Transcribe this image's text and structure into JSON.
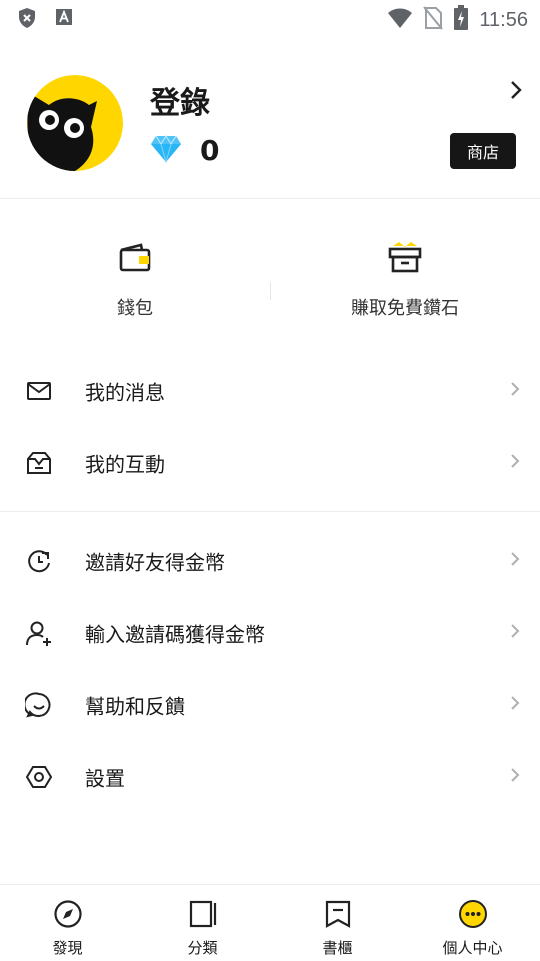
{
  "status_bar": {
    "time": "11:56",
    "icons": [
      "shield-icon",
      "font-icon",
      "wifi-icon",
      "no-sim-icon",
      "battery-charging-icon"
    ]
  },
  "profile": {
    "login_label": "登錄",
    "diamond_count": "0",
    "shop_label": "商店"
  },
  "quick_actions": [
    {
      "label": "錢包",
      "icon": "wallet-icon"
    },
    {
      "label": "賺取免費鑽石",
      "icon": "gift-box-icon"
    }
  ],
  "menu_group_1": [
    {
      "label": "我的消息",
      "icon": "mail-icon"
    },
    {
      "label": "我的互動",
      "icon": "inbox-icon"
    }
  ],
  "menu_group_2": [
    {
      "label": "邀請好友得金幣",
      "icon": "invite-refresh-icon"
    },
    {
      "label": "輸入邀請碼獲得金幣",
      "icon": "add-user-icon"
    },
    {
      "label": "幫助和反饋",
      "icon": "feedback-smile-icon"
    },
    {
      "label": "設置",
      "icon": "settings-hexagon-icon"
    }
  ],
  "tab_bar": [
    {
      "label": "發現",
      "icon": "compass-icon"
    },
    {
      "label": "分類",
      "icon": "book-stack-icon"
    },
    {
      "label": "書櫃",
      "icon": "bookshelf-icon"
    },
    {
      "label": "個人中心",
      "icon": "more-dots-icon",
      "active": true
    }
  ],
  "colors": {
    "accent": "#FFD600",
    "shop_button": "#161616",
    "diamond": "#4FC3F7"
  }
}
